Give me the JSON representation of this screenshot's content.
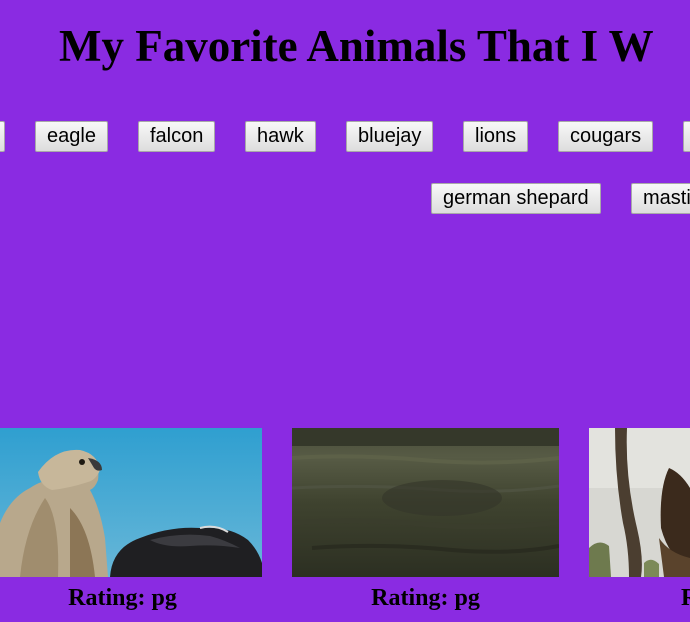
{
  "title": "My Favorite Animals That I W",
  "buttons": [
    {
      "label": "eagle"
    },
    {
      "label": "falcon"
    },
    {
      "label": "hawk"
    },
    {
      "label": "bluejay"
    },
    {
      "label": "lions"
    },
    {
      "label": "cougars"
    },
    {
      "label": "german shepard"
    },
    {
      "label": "masti"
    }
  ],
  "cards": [
    {
      "rating": "Rating: pg",
      "image": "eagle-photo"
    },
    {
      "rating": "Rating: pg",
      "image": "water-photo"
    },
    {
      "rating": "R",
      "image": "bird-branch-photo"
    }
  ]
}
